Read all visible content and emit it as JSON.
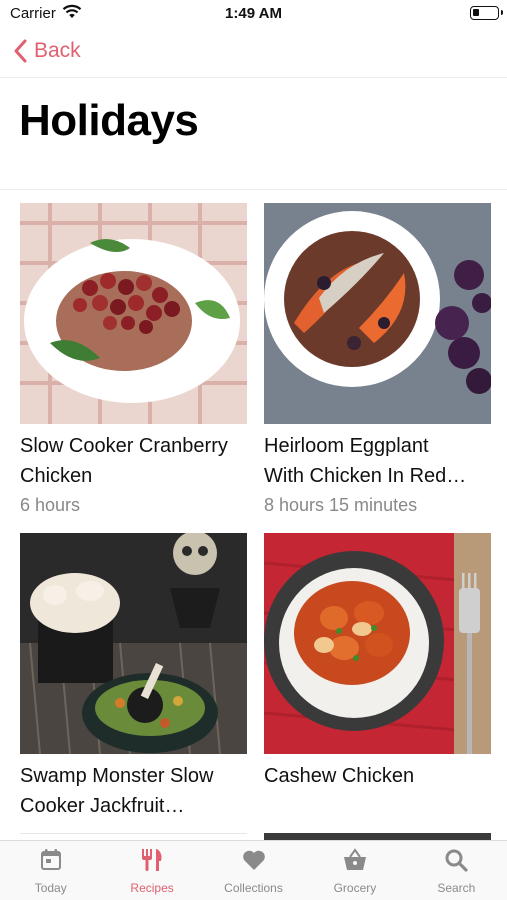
{
  "status_bar": {
    "carrier": "Carrier",
    "time": "1:49 AM"
  },
  "nav": {
    "back_label": "Back"
  },
  "page": {
    "title": "Holidays"
  },
  "recipes": [
    {
      "title_line1": "Slow Cooker Cranberry",
      "title_line2": "Chicken",
      "time": "6 hours"
    },
    {
      "title_line1": "Heirloom Eggplant",
      "title_line2": "With Chicken In Red…",
      "time": "8 hours 15 minutes"
    },
    {
      "title_line1": "Swamp Monster Slow",
      "title_line2": "Cooker Jackfruit…",
      "time": ""
    },
    {
      "title_line1": "Cashew Chicken",
      "title_line2": "",
      "time": ""
    }
  ],
  "tabs": [
    {
      "label": "Today",
      "icon": "calendar-icon",
      "active": false
    },
    {
      "label": "Recipes",
      "icon": "fork-knife-icon",
      "active": true
    },
    {
      "label": "Collections",
      "icon": "heart-icon",
      "active": false
    },
    {
      "label": "Grocery",
      "icon": "basket-icon",
      "active": false
    },
    {
      "label": "Search",
      "icon": "search-icon",
      "active": false
    }
  ],
  "colors": {
    "accent": "#e0606f",
    "inactive": "#8a8a8a"
  }
}
